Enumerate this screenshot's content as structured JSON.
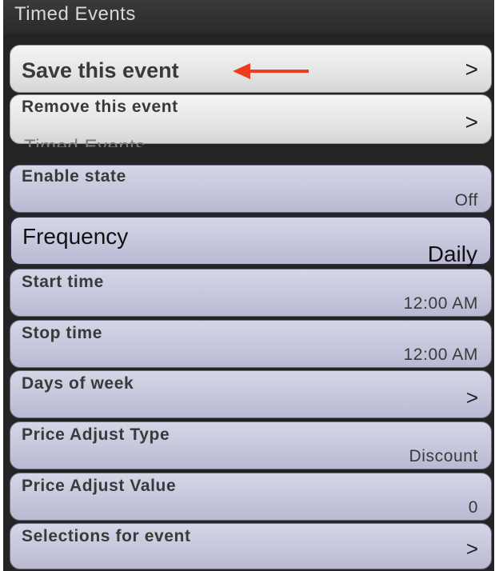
{
  "header": {
    "title": "Timed Events"
  },
  "actions": {
    "save_label": "Save this event",
    "save_chevron": ">",
    "remove_label": "Remove this event",
    "remove_chevron": ">"
  },
  "settings": [
    {
      "label": "Enable state",
      "value": "Off"
    },
    {
      "label": "Frequency",
      "value": "Daily"
    },
    {
      "label": "Start time",
      "value": "12:00 AM"
    },
    {
      "label": "Stop time",
      "value": "12:00 AM"
    },
    {
      "label": "Days of week",
      "value": ">"
    },
    {
      "label": "Price Adjust Type",
      "value": "Discount"
    },
    {
      "label": "Price Adjust Value",
      "value": "0"
    },
    {
      "label": "Selections for event",
      "value": ">"
    }
  ],
  "colors": {
    "accent_arrow": "#f03c1c",
    "panel": "#242424",
    "row": "#c9c9df"
  },
  "icons": {
    "annotation": "left-arrow-icon",
    "chevron": "chevron-right-icon"
  }
}
